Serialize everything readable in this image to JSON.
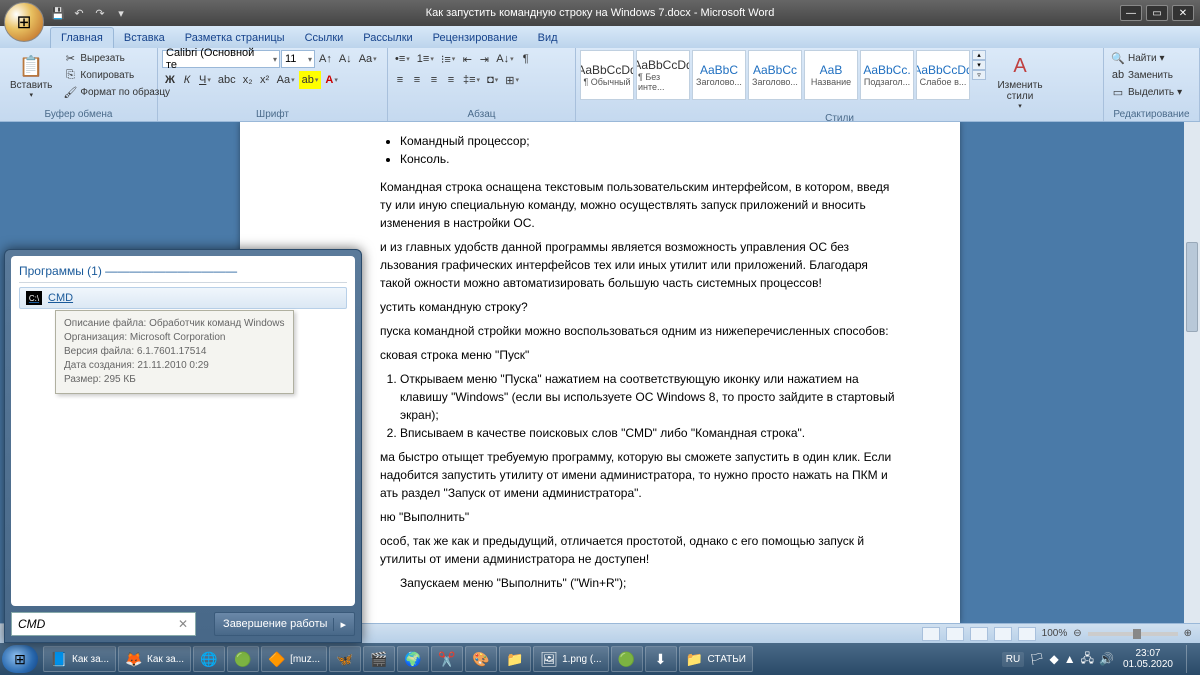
{
  "title": "Как запустить командную строку на Windows 7.docx  -  Microsoft Word",
  "tabs": [
    "Главная",
    "Вставка",
    "Разметка страницы",
    "Ссылки",
    "Рассылки",
    "Рецензирование",
    "Вид"
  ],
  "clipboard": {
    "paste": "Вставить",
    "cut": "Вырезать",
    "copy": "Копировать",
    "format": "Формат по образцу",
    "label": "Буфер обмена"
  },
  "font": {
    "name": "Calibri (Основной те",
    "size": "11",
    "label": "Шрифт"
  },
  "paragraph": {
    "label": "Абзац"
  },
  "styles": {
    "label": "Стили",
    "items": [
      {
        "preview": "AaBbCcDd",
        "name": "¶ Обычный"
      },
      {
        "preview": "AaBbCcDd",
        "name": "¶ Без инте..."
      },
      {
        "preview": "AaBbC",
        "name": "Заголово...",
        "blue": true
      },
      {
        "preview": "AaBbCc",
        "name": "Заголово...",
        "blue": true
      },
      {
        "preview": "AaB",
        "name": "Название",
        "blue": true
      },
      {
        "preview": "AaBbCc.",
        "name": "Подзагол...",
        "blue": true
      },
      {
        "preview": "AaBbCcDd",
        "name": "Слабое в...",
        "blue": true
      }
    ],
    "change": "Изменить стили"
  },
  "editing": {
    "find": "Найти",
    "replace": "Заменить",
    "select": "Выделить",
    "label": "Редактирование"
  },
  "doc": {
    "bullets": [
      "Командный процессор;",
      "Консоль."
    ],
    "p1": "Командная строка оснащена текстовым пользовательским интерфейсом, в котором, введя ту или иную специальную команду, можно осуществлять запуск приложений и вносить изменения в настройки ОС.",
    "p2": "и из главных удобств данной программы является возможность управления ОС без льзования графических интерфейсов тех или иных утилит или приложений. Благодаря такой ожности можно автоматизировать большую часть системных процессов!",
    "p3": "устить командную строку?",
    "p4": "пуска командной стройки можно воспользоваться одним из нижеперечисленных способов:",
    "p5": "сковая строка меню \"Пуск\"",
    "li1": "Открываем меню \"Пуска\" нажатием на соответствующую иконку или нажатием на клавишу \"Windows\" (если вы используете ОС Windows 8, то просто зайдите в стартовый экран);",
    "li2": "Вписываем в качестве поисковых слов \"CMD\" либо \"Командная строка\".",
    "p6": "ма быстро отыщет требуемую программу, которую вы сможете запустить в один клик. Если надобится запустить утилиту от имени администратора, то нужно просто нажать на ПКМ и ать раздел \"Запуск от имени администратора\".",
    "p7": "ню \"Выполнить\"",
    "p8": "особ, так же как и предыдущий, отличается простотой, однако с его помощью запуск й утилиты от имени администратора не доступен!",
    "p9": "Запускаем меню \"Выполнить\" (\"Win+R\");"
  },
  "zoom": "100%",
  "start": {
    "header": "Программы (1)",
    "item": "CMD",
    "tip": {
      "l1": "Описание файла: Обработчик команд Windows",
      "l2": "Организация: Microsoft Corporation",
      "l3": "Версия файла: 6.1.7601.17514",
      "l4": "Дата создания: 21.11.2010 0:29",
      "l5": "Размер: 295 КБ"
    },
    "search": "CMD",
    "shutdown": "Завершение работы"
  },
  "taskbar": {
    "items": [
      {
        "ico": "📘",
        "label": "Как за..."
      },
      {
        "ico": "🦊",
        "label": "Как за..."
      },
      {
        "ico": "🌐",
        "label": ""
      },
      {
        "ico": "🟢",
        "label": ""
      },
      {
        "ico": "🔶",
        "label": "[muz..."
      },
      {
        "ico": "🦋",
        "label": ""
      },
      {
        "ico": "🎬",
        "label": ""
      },
      {
        "ico": "🌍",
        "label": ""
      },
      {
        "ico": "✂️",
        "label": ""
      },
      {
        "ico": "🎨",
        "label": ""
      },
      {
        "ico": "📁",
        "label": ""
      },
      {
        "ico": "🖼",
        "label": "1.png (..."
      },
      {
        "ico": "🟢",
        "label": ""
      },
      {
        "ico": "⬇",
        "label": ""
      },
      {
        "ico": "📁",
        "label": "СТАТЬИ"
      }
    ],
    "lang": "RU",
    "time": "23:07",
    "date": "01.05.2020"
  }
}
